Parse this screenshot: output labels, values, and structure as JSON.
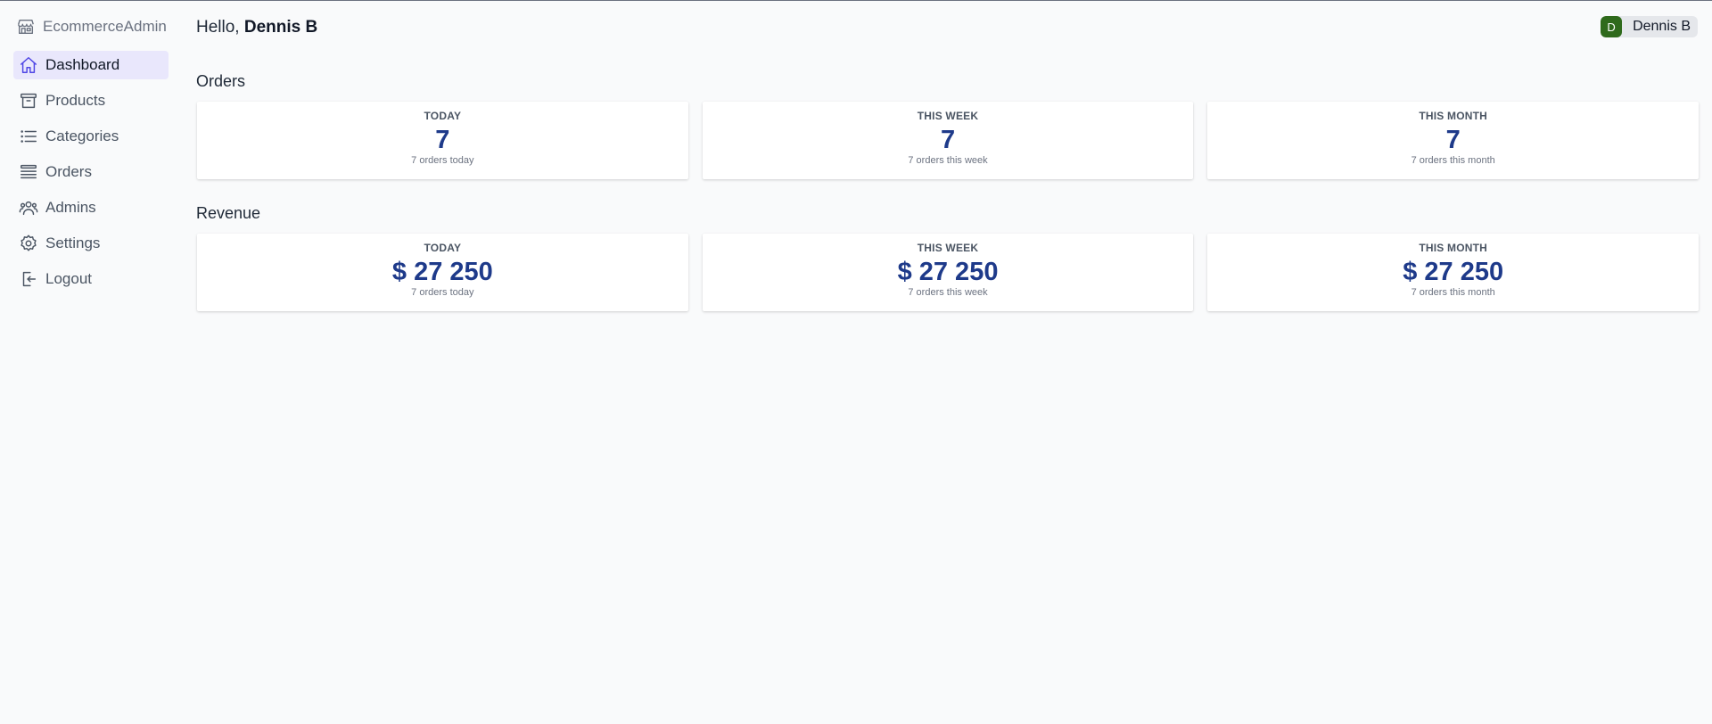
{
  "brand": {
    "name": "EcommerceAdmin",
    "icon": "store-icon"
  },
  "nav": [
    {
      "label": "Dashboard",
      "icon": "home-icon",
      "active": true
    },
    {
      "label": "Products",
      "icon": "archive-icon",
      "active": false
    },
    {
      "label": "Categories",
      "icon": "list-icon",
      "active": false
    },
    {
      "label": "Orders",
      "icon": "queue-icon",
      "active": false
    },
    {
      "label": "Admins",
      "icon": "users-icon",
      "active": false
    },
    {
      "label": "Settings",
      "icon": "gear-icon",
      "active": false
    },
    {
      "label": "Logout",
      "icon": "logout-icon",
      "active": false
    }
  ],
  "header": {
    "greeting_prefix": "Hello,",
    "user_name": "Dennis B",
    "avatar_initial": "D",
    "avatar_color": "#2f6a1c"
  },
  "orders": {
    "title": "Orders",
    "cards": [
      {
        "label": "TODAY",
        "value": "7",
        "sub": "7 orders today"
      },
      {
        "label": "THIS WEEK",
        "value": "7",
        "sub": "7 orders this week"
      },
      {
        "label": "THIS MONTH",
        "value": "7",
        "sub": "7 orders this month"
      }
    ]
  },
  "revenue": {
    "title": "Revenue",
    "cards": [
      {
        "label": "TODAY",
        "value": "$ 27 250",
        "sub": "7 orders today"
      },
      {
        "label": "THIS WEEK",
        "value": "$ 27 250",
        "sub": "7 orders this week"
      },
      {
        "label": "THIS MONTH",
        "value": "$ 27 250",
        "sub": "7 orders this month"
      }
    ]
  },
  "colors": {
    "accent": "#4f46e5",
    "active_bg": "#e9e7fc",
    "value_text": "#1e3a8a"
  }
}
